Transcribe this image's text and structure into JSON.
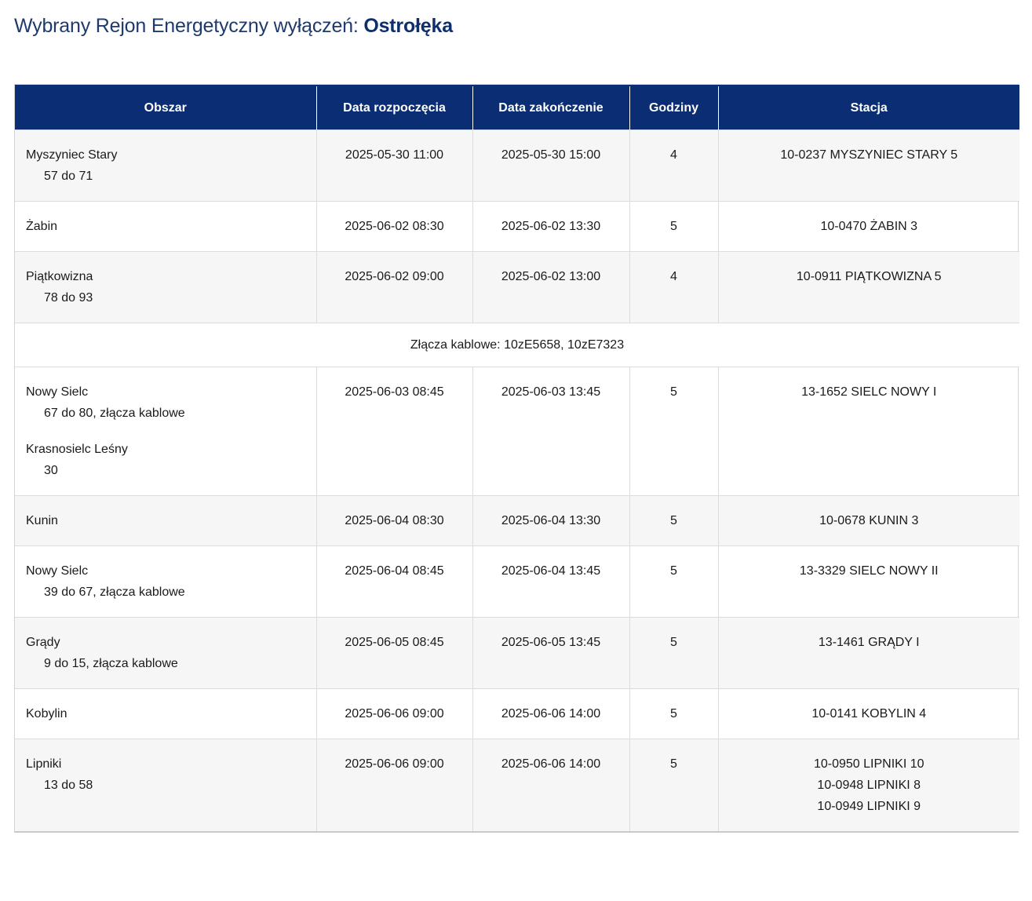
{
  "header": {
    "title_prefix": "Wybrany Rejon Energetyczny wyłączeń:",
    "region": "Ostrołęka"
  },
  "table": {
    "columns": [
      "Obszar",
      "Data rozpoczęcia",
      "Data zakończenie",
      "Godziny",
      "Stacja"
    ],
    "rows": [
      {
        "areas": [
          {
            "name": "Myszyniec Stary",
            "detail": "57 do 71"
          }
        ],
        "start": "2025-05-30 11:00",
        "end": "2025-05-30 15:00",
        "hours": "4",
        "stations": [
          "10-0237 MYSZYNIEC STARY 5"
        ]
      },
      {
        "areas": [
          {
            "name": "Żabin",
            "detail": ""
          }
        ],
        "start": "2025-06-02 08:30",
        "end": "2025-06-02 13:30",
        "hours": "5",
        "stations": [
          "10-0470 ŻABIN 3"
        ]
      },
      {
        "areas": [
          {
            "name": "Piątkowizna",
            "detail": "78 do 93"
          }
        ],
        "start": "2025-06-02 09:00",
        "end": "2025-06-02 13:00",
        "hours": "4",
        "stations": [
          "10-0911 PIĄTKOWIZNA 5"
        ]
      },
      {
        "note": "Złącza kablowe: 10zE5658, 10zE7323"
      },
      {
        "areas": [
          {
            "name": "Nowy Sielc",
            "detail": "67 do 80, złącza kablowe"
          },
          {
            "name": "Krasnosielc Leśny",
            "detail": "30"
          }
        ],
        "start": "2025-06-03 08:45",
        "end": "2025-06-03 13:45",
        "hours": "5",
        "stations": [
          "13-1652 SIELC NOWY I"
        ]
      },
      {
        "areas": [
          {
            "name": "Kunin",
            "detail": ""
          }
        ],
        "start": "2025-06-04 08:30",
        "end": "2025-06-04 13:30",
        "hours": "5",
        "stations": [
          "10-0678 KUNIN 3"
        ]
      },
      {
        "areas": [
          {
            "name": "Nowy Sielc",
            "detail": "39 do 67, złącza kablowe"
          }
        ],
        "start": "2025-06-04 08:45",
        "end": "2025-06-04 13:45",
        "hours": "5",
        "stations": [
          "13-3329 SIELC NOWY II"
        ]
      },
      {
        "areas": [
          {
            "name": "Grądy",
            "detail": "9 do 15, złącza kablowe"
          }
        ],
        "start": "2025-06-05 08:45",
        "end": "2025-06-05 13:45",
        "hours": "5",
        "stations": [
          "13-1461 GRĄDY I"
        ]
      },
      {
        "areas": [
          {
            "name": "Kobylin",
            "detail": ""
          }
        ],
        "start": "2025-06-06 09:00",
        "end": "2025-06-06 14:00",
        "hours": "5",
        "stations": [
          "10-0141 KOBYLIN 4"
        ]
      },
      {
        "areas": [
          {
            "name": "Lipniki",
            "detail": "13 do 58"
          }
        ],
        "start": "2025-06-06 09:00",
        "end": "2025-06-06 14:00",
        "hours": "5",
        "stations": [
          "10-0950 LIPNIKI 10",
          "10-0948 LIPNIKI 8",
          "10-0949 LIPNIKI 9"
        ]
      }
    ]
  }
}
